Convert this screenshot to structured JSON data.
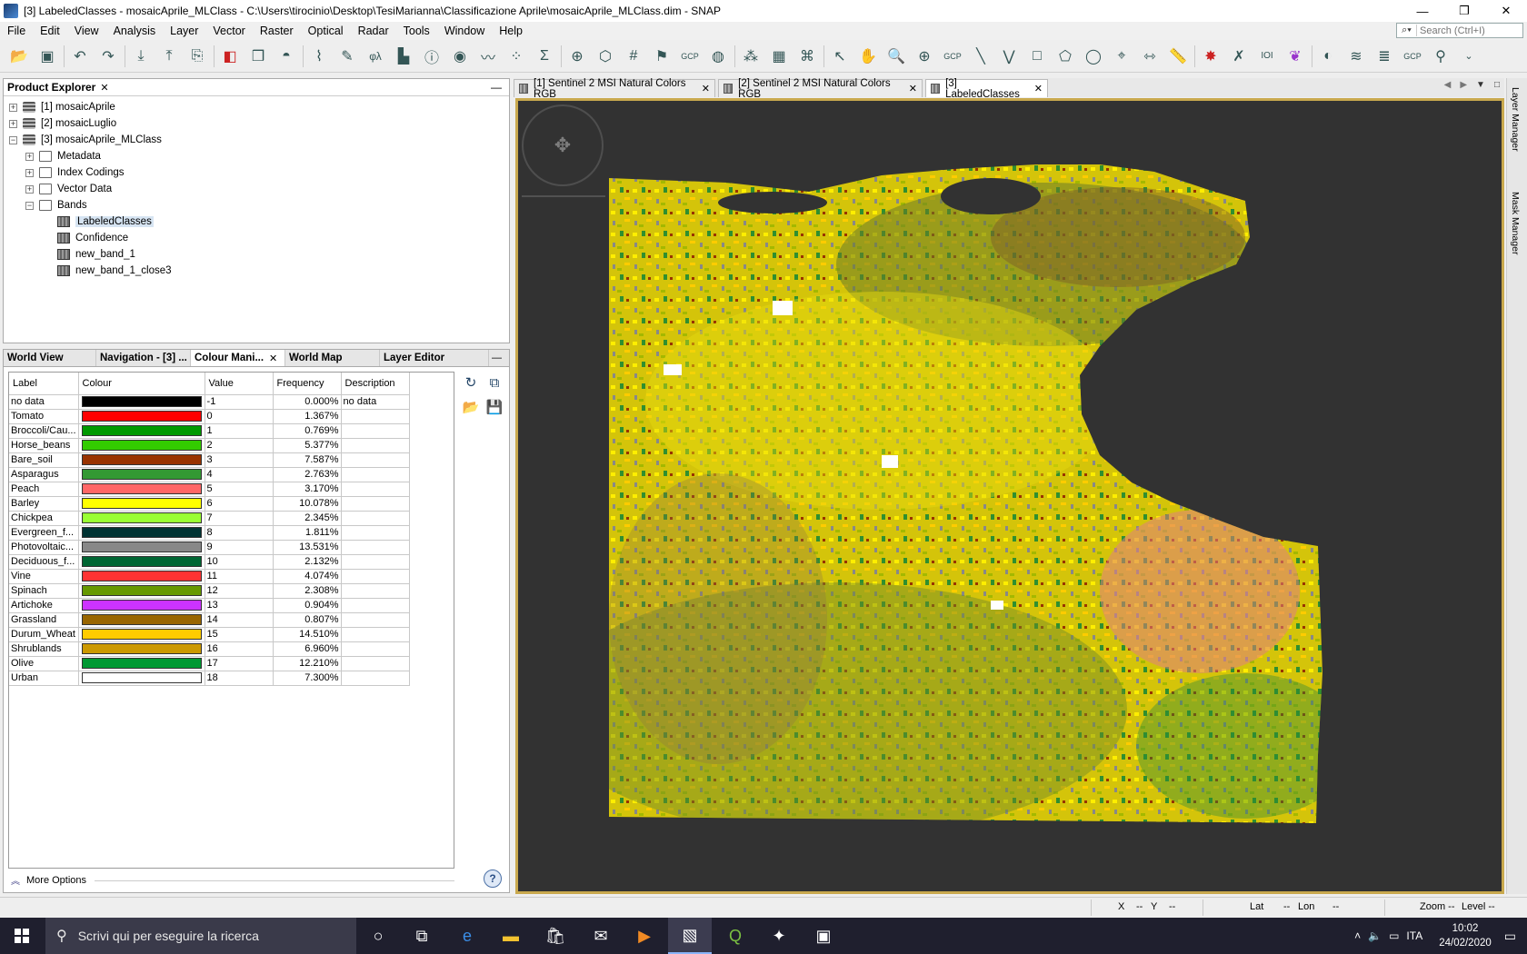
{
  "window": {
    "title": "[3] LabeledClasses - mosaicAprile_MLClass - C:\\Users\\tirocinio\\Desktop\\TesiMarianna\\Classificazione Aprile\\mosaicAprile_MLClass.dim - SNAP",
    "controls": [
      "—",
      "❐",
      "✕"
    ]
  },
  "menu": [
    "File",
    "Edit",
    "View",
    "Analysis",
    "Layer",
    "Vector",
    "Raster",
    "Optical",
    "Radar",
    "Tools",
    "Window",
    "Help"
  ],
  "search": {
    "placeholder": "Search (Ctrl+I)"
  },
  "toolbar": {
    "icons": [
      "open-product-icon",
      "save-product-icon",
      "undo-icon",
      "redo-icon",
      "import-icon",
      "export-icon",
      "session-icon",
      "colour-palette-icon",
      "layers-icon",
      "water-icon",
      "spectrum-icon",
      "edit-icon",
      "phi-lambda-icon",
      "histogram-icon",
      "information-icon",
      "analysis-icon",
      "profile-icon",
      "scatter-plot-icon",
      "sum-icon",
      "subset-icon",
      "mosaic-icon",
      "grid-icon",
      "pixel-info-icon",
      "gcp-icon",
      "world-view-icon",
      "graph-builder-icon",
      "batch-icon",
      "band-maths-icon",
      "select-tool-icon",
      "pan-tool-icon",
      "zoom-tool-icon",
      "zoom-in-icon",
      "gcp-tool-icon",
      "line-tool-icon",
      "polyline-tool-icon",
      "rectangle-tool-icon",
      "polygon-tool-icon",
      "ellipse-tool-icon",
      "magic-wand-icon",
      "range-finder-icon",
      "ruler-icon",
      "star-icon",
      "xy-icon",
      "binary-icon",
      "mask-icon",
      "sphere-icon",
      "terrain-icon",
      "terrain2-icon",
      "gcp2-icon",
      "search-tool-icon"
    ],
    "gcp_label": "GCP"
  },
  "product_explorer": {
    "title": "Product Explorer",
    "products": [
      "[1] mosaicAprile",
      "[2] mosaicLuglio",
      "[3] mosaicAprile_MLClass"
    ],
    "folders": [
      "Metadata",
      "Index Codings",
      "Vector Data",
      "Bands"
    ],
    "bands": [
      "LabeledClasses",
      "Confidence",
      "new_band_1",
      "new_band_1_close3"
    ]
  },
  "tool_tabs": [
    "World View",
    "Navigation - [3] ...",
    "Colour Mani...",
    "World Map",
    "Layer Editor"
  ],
  "colour_table": {
    "headers": [
      "Label",
      "Colour",
      "Value",
      "Frequency",
      "Description"
    ],
    "rows": [
      {
        "label": "no data",
        "color": "#000000",
        "value": "-1",
        "frequency": "0.000%",
        "description": "no data"
      },
      {
        "label": "Tomato",
        "color": "#ff0000",
        "value": "0",
        "frequency": "1.367%",
        "description": ""
      },
      {
        "label": "Broccoli/Cau...",
        "color": "#009900",
        "value": "1",
        "frequency": "0.769%",
        "description": ""
      },
      {
        "label": "Horse_beans",
        "color": "#33cc00",
        "value": "2",
        "frequency": "5.377%",
        "description": ""
      },
      {
        "label": "Bare_soil",
        "color": "#993300",
        "value": "3",
        "frequency": "7.587%",
        "description": ""
      },
      {
        "label": "Asparagus",
        "color": "#339933",
        "value": "4",
        "frequency": "2.763%",
        "description": ""
      },
      {
        "label": "Peach",
        "color": "#ff6666",
        "value": "5",
        "frequency": "3.170%",
        "description": ""
      },
      {
        "label": "Barley",
        "color": "#ffff00",
        "value": "6",
        "frequency": "10.078%",
        "description": ""
      },
      {
        "label": "Chickpea",
        "color": "#99ff33",
        "value": "7",
        "frequency": "2.345%",
        "description": ""
      },
      {
        "label": "Evergreen_f...",
        "color": "#003333",
        "value": "8",
        "frequency": "1.811%",
        "description": ""
      },
      {
        "label": "Photovoltaic...",
        "color": "#888888",
        "value": "9",
        "frequency": "13.531%",
        "description": ""
      },
      {
        "label": "Deciduous_f...",
        "color": "#006633",
        "value": "10",
        "frequency": "2.132%",
        "description": ""
      },
      {
        "label": "Vine",
        "color": "#ff3333",
        "value": "11",
        "frequency": "4.074%",
        "description": ""
      },
      {
        "label": "Spinach",
        "color": "#669900",
        "value": "12",
        "frequency": "2.308%",
        "description": ""
      },
      {
        "label": "Artichoke",
        "color": "#cc33ff",
        "value": "13",
        "frequency": "0.904%",
        "description": ""
      },
      {
        "label": "Grassland",
        "color": "#996600",
        "value": "14",
        "frequency": "0.807%",
        "description": ""
      },
      {
        "label": "Durum_Wheat",
        "color": "#ffcc00",
        "value": "15",
        "frequency": "14.510%",
        "description": ""
      },
      {
        "label": "Shrublands",
        "color": "#cc9900",
        "value": "16",
        "frequency": "6.960%",
        "description": ""
      },
      {
        "label": "Olive",
        "color": "#009933",
        "value": "17",
        "frequency": "12.210%",
        "description": ""
      },
      {
        "label": "Urban",
        "color": "#ffffff",
        "value": "18",
        "frequency": "7.300%",
        "description": ""
      }
    ]
  },
  "more_options": "More Options",
  "doc_tabs": [
    "[1] Sentinel 2 MSI Natural Colors RGB",
    "[2] Sentinel 2 MSI Natural Colors RGB",
    "[3] LabeledClasses"
  ],
  "right_tabs": [
    "Layer Manager",
    "Mask Manager"
  ],
  "status": {
    "x": "X",
    "x_val": "--",
    "y": "Y",
    "y_val": "--",
    "lat": "Lat",
    "lat_val": "--",
    "lon": "Lon",
    "lon_val": "--",
    "zoom": "Zoom --",
    "level": "Level --"
  },
  "taskbar": {
    "search_placeholder": "Scrivi qui per eseguire la ricerca",
    "language": "ITA",
    "time": "10:02",
    "date": "24/02/2020"
  }
}
